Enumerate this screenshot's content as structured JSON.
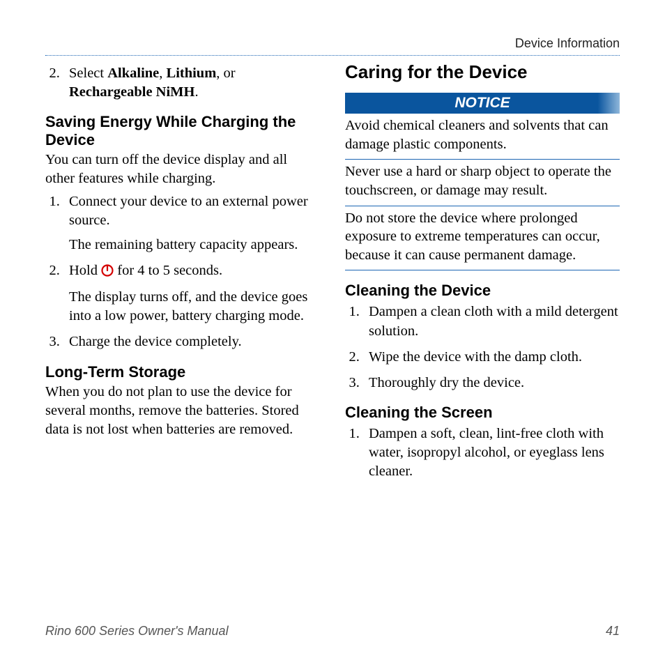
{
  "header": {
    "section": "Device Information"
  },
  "left": {
    "list1": {
      "item2_prefix": "Select ",
      "item2_b1": "Alkaline",
      "item2_mid1": ", ",
      "item2_b2": "Lithium",
      "item2_mid2": ", or ",
      "item2_b3": "Rechargeable NiMH",
      "item2_suffix": "."
    },
    "saving": {
      "heading": "Saving Energy While Charging the Device",
      "intro": "You can turn off the device display and all other features while charging.",
      "step1": "Connect your device to an external power source.",
      "step1_sub": "The remaining battery capacity appears.",
      "step2_a": "Hold ",
      "step2_b": " for 4 to 5 seconds.",
      "step2_sub": "The display turns off, and the device goes into a low power, battery charging mode.",
      "step3": "Charge the device completely."
    },
    "storage": {
      "heading": "Long-Term Storage",
      "body": "When you do not plan to use the device for several months, remove the batteries. Stored data is not lost when batteries are removed."
    }
  },
  "right": {
    "caring_heading": "Caring for the Device",
    "notice_label": "NOTICE",
    "notice1": "Avoid chemical cleaners and solvents that can damage plastic components.",
    "notice2": "Never use a hard or sharp object to operate the touchscreen, or damage may result.",
    "notice3": "Do not store the device where prolonged exposure to extreme temperatures can occur, because it can cause permanent damage.",
    "clean_device": {
      "heading": "Cleaning the Device",
      "step1": "Dampen a clean cloth with a mild detergent solution.",
      "step2": "Wipe the device with the damp cloth.",
      "step3": "Thoroughly dry the device."
    },
    "clean_screen": {
      "heading": "Cleaning the Screen",
      "step1": "Dampen a soft, clean, lint-free cloth with water, isopropyl alcohol, or eyeglass lens cleaner."
    }
  },
  "footer": {
    "title": "Rino 600 Series Owner's Manual",
    "page": "41"
  }
}
